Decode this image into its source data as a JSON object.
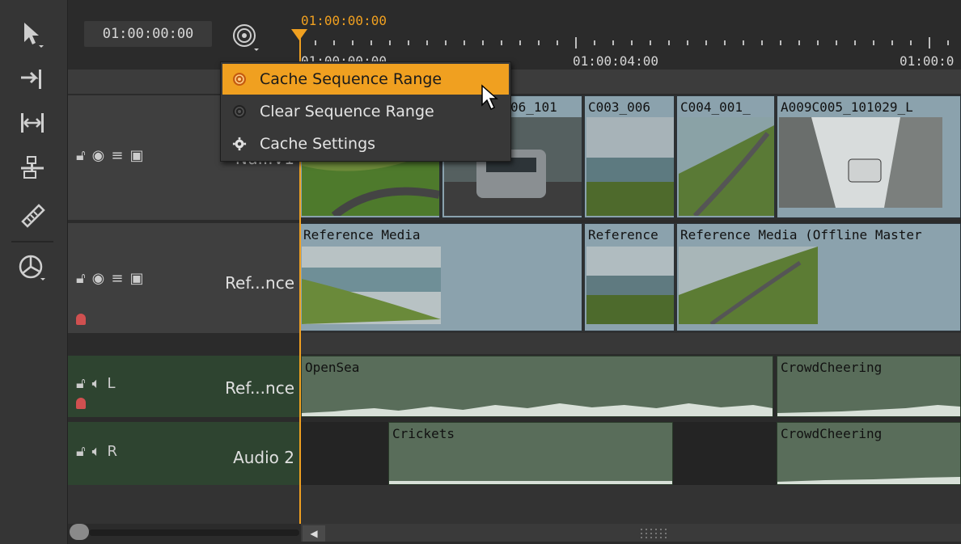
{
  "header": {
    "timecode": "01:00:00:00",
    "playhead_timecode": "01:00:00:00",
    "ruler_labels": [
      "01:00:00:00",
      "01:00:04:00",
      "01:00:0"
    ]
  },
  "tools": [
    {
      "name": "select-icon"
    },
    {
      "name": "move-track-icon"
    },
    {
      "name": "trim-icon"
    },
    {
      "name": "slip-icon"
    },
    {
      "name": "razor-icon"
    },
    {
      "name": "multi-view-icon"
    }
  ],
  "tracks": {
    "video1": {
      "name": "Nu...V1"
    },
    "reference": {
      "name": "Ref...nce"
    },
    "audio_ref": {
      "name": "Ref...nce",
      "channel": "L"
    },
    "audio2": {
      "name": "Audio 2",
      "channel": "R"
    }
  },
  "clips": {
    "v1": [
      "06_101",
      "C003_006",
      "C004_001_",
      "A009C005_101029_L"
    ],
    "ref": [
      "Reference Media",
      "Reference",
      "Reference Media (Offline Master"
    ],
    "audio_ref": [
      "OpenSea",
      "CrowdCheering"
    ],
    "audio2": [
      "Crickets",
      "CrowdCheering"
    ]
  },
  "menu": {
    "items": [
      {
        "label": "Cache Sequence Range",
        "icon": "cache-active-icon"
      },
      {
        "label": "Clear Sequence Range",
        "icon": "cache-clear-icon"
      },
      {
        "label": "Cache Settings",
        "icon": "gear-icon"
      }
    ]
  },
  "colors": {
    "accent": "#f0a020",
    "video_clip": "#8ba2ad",
    "audio_clip": "#596d5a"
  }
}
